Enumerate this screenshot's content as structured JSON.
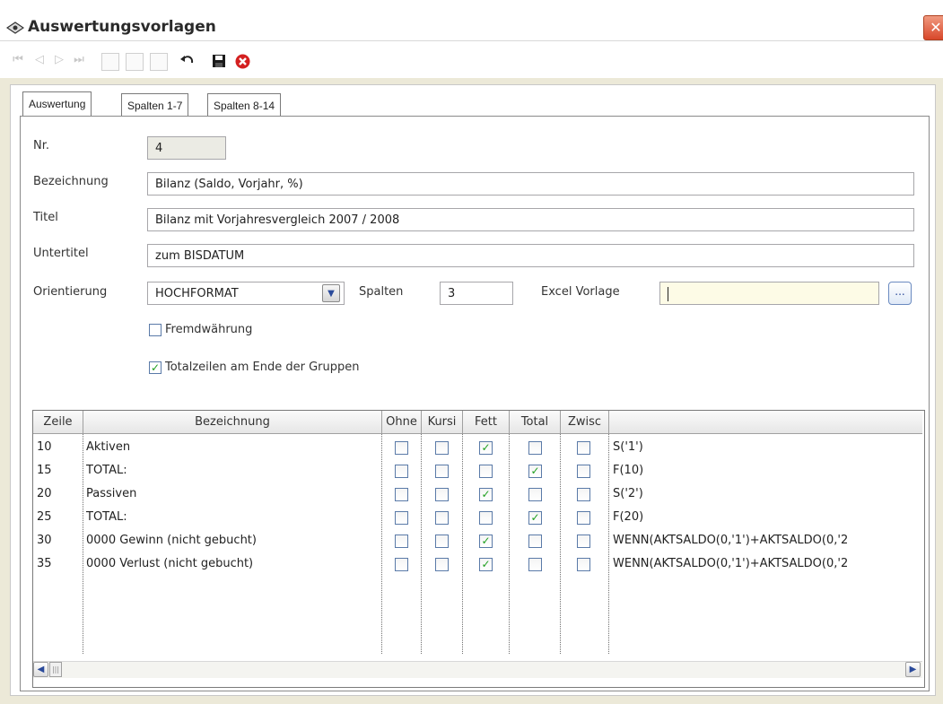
{
  "window": {
    "title": "Auswertungsvorlagen",
    "close_label": "✕"
  },
  "tabs": [
    {
      "label": "Auswertung",
      "active": true
    },
    {
      "label": "Spalten 1-7",
      "active": false
    },
    {
      "label": "Spalten 8-14",
      "active": false
    }
  ],
  "form": {
    "nr_label": "Nr.",
    "nr_value": "4",
    "bezeichnung_label": "Bezeichnung",
    "bezeichnung_value": "Bilanz (Saldo, Vorjahr, %)",
    "titel_label": "Titel",
    "titel_value": "Bilanz mit Vorjahresvergleich 2007 / 2008",
    "untertitel_label": "Untertitel",
    "untertitel_value": "zum BISDATUM",
    "orientierung_label": "Orientierung",
    "orientierung_value": "HOCHFORMAT",
    "spalten_label": "Spalten",
    "spalten_value": "3",
    "excel_label": "Excel Vorlage",
    "excel_value": "",
    "ellipsis_label": "...",
    "fremdwaehrung_label": "Fremdwährung",
    "fremdwaehrung_checked": false,
    "totalzeilen_label": "Totalzeilen am Ende der Gruppen",
    "totalzeilen_checked": true
  },
  "grid": {
    "headers": [
      "Zeile",
      "Bezeichnung",
      "Ohne",
      "Kursi",
      "Fett",
      "Total",
      "Zwisc",
      ""
    ],
    "rows": [
      {
        "zeile": "10",
        "bezeichnung": "Aktiven",
        "ohne": false,
        "kursiv": false,
        "fett": true,
        "total": false,
        "zwisc": false,
        "formel": "S('1')"
      },
      {
        "zeile": "15",
        "bezeichnung": "TOTAL:",
        "ohne": false,
        "kursiv": false,
        "fett": false,
        "total": true,
        "zwisc": false,
        "formel": "F(10)"
      },
      {
        "zeile": "20",
        "bezeichnung": "Passiven",
        "ohne": false,
        "kursiv": false,
        "fett": true,
        "total": false,
        "zwisc": false,
        "formel": "S('2')"
      },
      {
        "zeile": "25",
        "bezeichnung": "TOTAL:",
        "ohne": false,
        "kursiv": false,
        "fett": false,
        "total": true,
        "zwisc": false,
        "formel": "F(20)"
      },
      {
        "zeile": "30",
        "bezeichnung": "0000 Gewinn (nicht gebucht)",
        "ohne": false,
        "kursiv": false,
        "fett": true,
        "total": false,
        "zwisc": false,
        "formel": "WENN(AKTSALDO(0,'1')+AKTSALDO(0,'2"
      },
      {
        "zeile": "35",
        "bezeichnung": "0000 Verlust (nicht gebucht)",
        "ohne": false,
        "kursiv": false,
        "fett": true,
        "total": false,
        "zwisc": false,
        "formel": "WENN(AKTSALDO(0,'1')+AKTSALDO(0,'2"
      }
    ]
  },
  "scroll": {
    "left_label": "◀",
    "right_label": "▶",
    "thumb_label": "|||"
  },
  "colors": {
    "check": "#20a020",
    "save": "#1a1a1a",
    "cancel": "#d42020"
  }
}
